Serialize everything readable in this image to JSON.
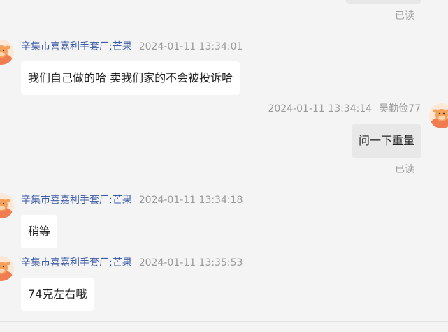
{
  "read_label": "已读",
  "messages": [
    {
      "sender": "辛集市喜嘉利手套厂:芒果",
      "time": "2024-01-11 13:34:01",
      "text": "我们自己做的哈 卖我们家的不会被投诉哈"
    },
    {
      "sender": "吴勤俭77",
      "time": "2024-01-11 13:34:14",
      "text": "问一下重量"
    },
    {
      "sender": "辛集市喜嘉利手套厂:芒果",
      "time": "2024-01-11 13:34:18",
      "text": "稍等"
    },
    {
      "sender": "辛集市喜嘉利手套厂:芒果",
      "time": "2024-01-11 13:35:53",
      "text": "74克左右哦"
    }
  ],
  "colors": {
    "background": "#f4f4f4",
    "sender_name": "#3b5aa8",
    "timestamp": "#9a9a9a",
    "bubble_incoming": "#ffffff",
    "bubble_outgoing": "#e8e8e8"
  },
  "icons": {
    "avatar": "cartoon-cow-avatar-icon"
  }
}
